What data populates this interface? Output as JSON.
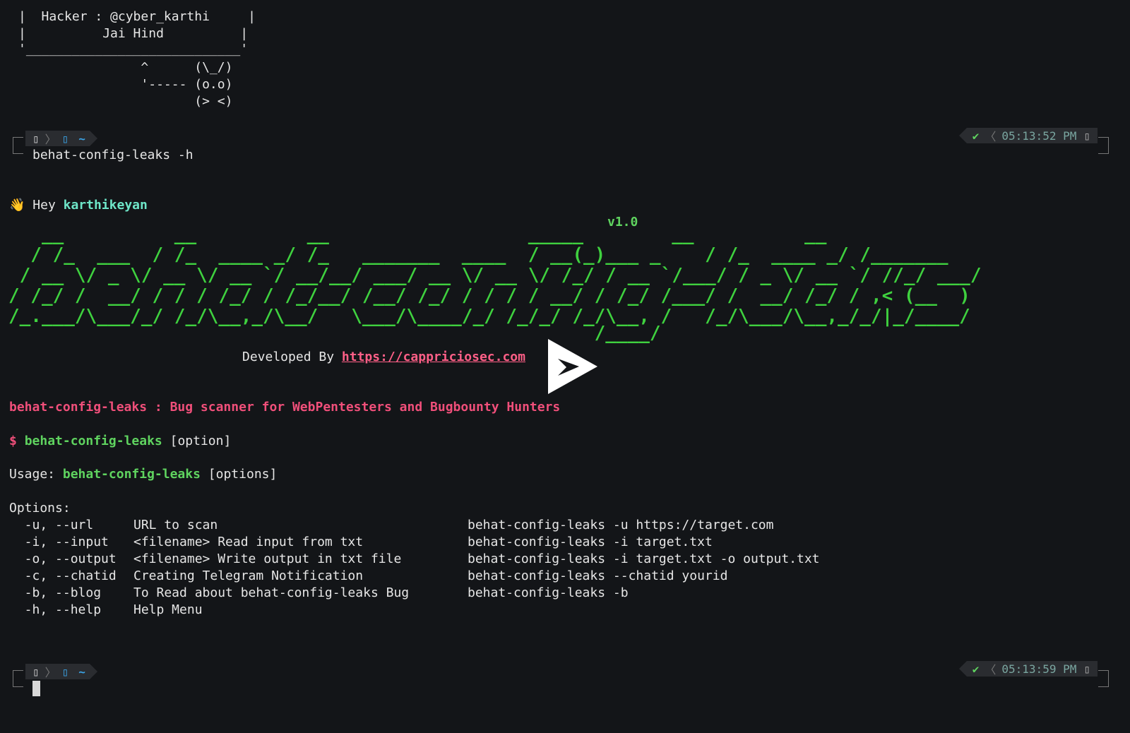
{
  "banner": {
    "hacker_line": "|  Hacker : @cyber_karthi     |",
    "jai_hind_line": "|          Jai Hind          |",
    "bottom_line": "'____________________________'",
    "creature_1": "                ^      (\\_/)",
    "creature_2": "                '----- (o.o)",
    "creature_3": "                       (> <)"
  },
  "prompt1": {
    "left_icon": "▯",
    "dir_icon": "▯",
    "dir": "~",
    "check": "✔",
    "time": "05:13:52 PM",
    "clock_icon": "▯",
    "command": "behat-config-leaks -h"
  },
  "greeting": {
    "emoji": "👋",
    "hey": "Hey",
    "name": "karthikeyan"
  },
  "version": "v1.0",
  "ascii_title": [
    "   __          __          __                  _____        __          __          ",
    "  / /_  ___  / /_  ____ _/ /_   _______  ____  / __(_)___ _    / /_  ____ _/ /_______",
    " / __ \\/ _ \\/ __ \\/ __ `/ __/__/ ___/ __ \\/ __ \\/ /_/ / __ `/___/ / _ \\/ __ `/ //_/ ___/",
    "/ /_/ /  __/ / / / /_/ / /_/__/ /__/ /_/ / / / / __/ / /_/ /___/ /  __/ /_/ / ,< (__  ) ",
    "/_.___/\\___/_/ /_/\\__,_/\\__/   \\___/\\____/_/ /_/_/ /_/\\__, /   /_/\\___/\\__,_/_/|_/____/  ",
    "                                                     /____/                            "
  ],
  "developed_by": {
    "label": "Developed By",
    "url": "https://cappriciosec.com"
  },
  "tagline": "behat-config-leaks : Bug scanner for WebPentesters and Bugbounty Hunters",
  "synopsis": {
    "dollar": "$",
    "cmd": "behat-config-leaks",
    "arg": "[option]"
  },
  "usage": {
    "label": "Usage:",
    "cmd": "behat-config-leaks",
    "arg": "[options]"
  },
  "options_header": "Options:",
  "options": [
    {
      "flag": "  -u, --url     ",
      "desc": "URL to scan",
      "example": "behat-config-leaks -u https://target.com"
    },
    {
      "flag": "  -i, --input   ",
      "desc": "<filename> Read input from txt",
      "example": "behat-config-leaks -i target.txt"
    },
    {
      "flag": "  -o, --output  ",
      "desc": "<filename> Write output in txt file",
      "example": "behat-config-leaks -i target.txt -o output.txt"
    },
    {
      "flag": "  -c, --chatid  ",
      "desc": "Creating Telegram Notification",
      "example": "behat-config-leaks --chatid yourid"
    },
    {
      "flag": "  -b, --blog    ",
      "desc": "To Read about behat-config-leaks Bug",
      "example": "behat-config-leaks -b"
    },
    {
      "flag": "  -h, --help    ",
      "desc": "Help Menu",
      "example": ""
    }
  ],
  "prompt2": {
    "left_icon": "▯",
    "dir_icon": "▯",
    "dir": "~",
    "check": "✔",
    "time": "05:13:59 PM",
    "clock_icon": "▯"
  },
  "colors": {
    "background": "#131518",
    "green": "#5fd35f",
    "pink": "#f04f7a",
    "cyan": "#6ee6c8"
  }
}
